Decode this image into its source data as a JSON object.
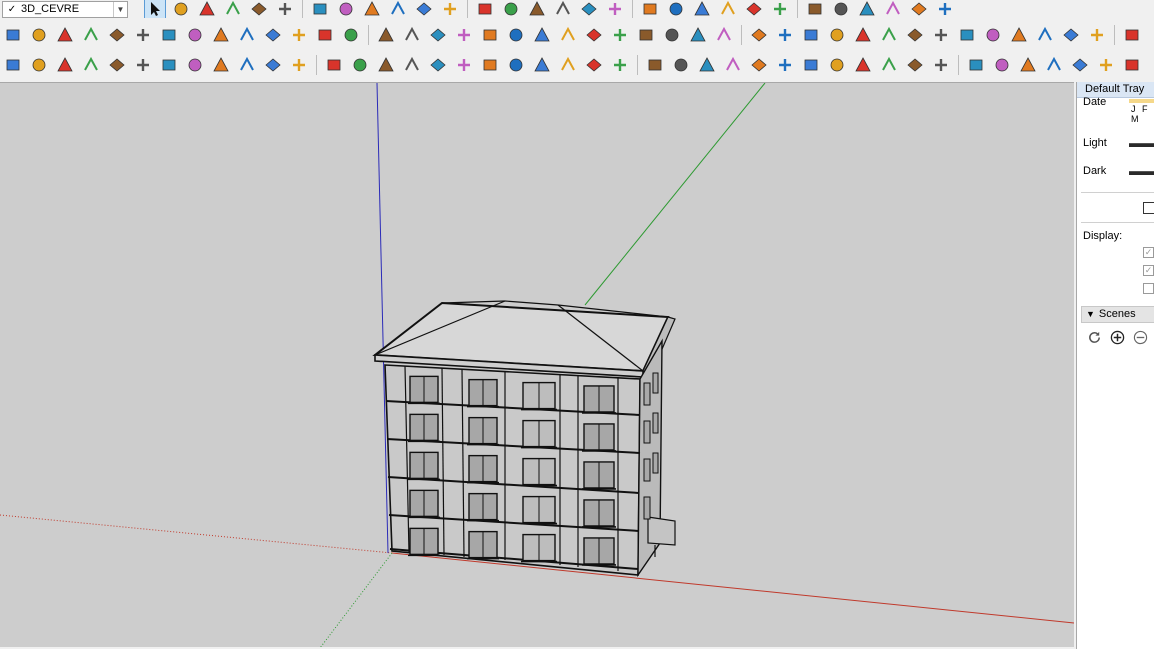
{
  "layer_dropdown": {
    "checkmark": "✓",
    "value": "3D_CEVRE",
    "arrow_icon": "chevron-down-icon"
  },
  "toolbar_row1": [
    "select-arrow-icon",
    "eraser-icon",
    "pencil-line-icon",
    "arc-icon",
    "rectangle-icon",
    "paint-bucket-icon",
    "push-pull-icon",
    "move-icon",
    "rotate-icon",
    "scale-icon",
    "tape-measure-icon",
    "text-icon",
    "paint-icon",
    "orbit-icon",
    "pan-icon",
    "zoom-icon",
    "zoom-extents-icon",
    "section-plane-icon",
    "warehouse-icon",
    "extension-icon",
    "user-account-icon",
    "house-icon",
    "house-front-icon",
    "house-outline-icon",
    "house-roof-icon",
    "layers-stack-icon",
    "layers-blue-icon",
    "layers-red-icon",
    "globe-icon",
    "export-icon"
  ],
  "toolbar_row2": [
    "cube-blue-icon",
    "plane-blue-icon",
    "plane-yellow-icon",
    "plane-green-icon",
    "plane-red-icon",
    "plane-white-icon",
    "undo-orange-icon",
    "stop-red-icon",
    "wall-icon",
    "flag-icon",
    "box-icon",
    "link-icon",
    "wave-icon",
    "curve-dots-icon",
    "cross-red-icon",
    "cross-green-icon",
    "grid-blue-icon",
    "prism-icon",
    "prism-green-icon",
    "warning-icon",
    "spiral-icon",
    "knot-icon",
    "knot-outline-icon",
    "move-arrows-icon",
    "tree-green-icon",
    "duplicate-icon",
    "tube-icon",
    "undo-red-icon",
    "stack-icon",
    "stack-red-icon",
    "tile-orange-icon",
    "mesh-icon",
    "window-icon",
    "grid-yellow-icon",
    "grid-orange-icon",
    "grid-orange2-icon",
    "scatter-icon",
    "circle-dots-icon",
    "qr-icon",
    "gray-box-icon",
    "component-icon",
    "component2-icon",
    "component3-icon"
  ],
  "toolbar_row3": [
    "logo-icon",
    "refresh-icon",
    "flag-stack-icon",
    "plus-circle-icon",
    "tree-icon",
    "terrain-icon",
    "checker-icon",
    "cloud-upload-icon",
    "settings-icon",
    "mail-icon",
    "info-icon",
    "offset-icon",
    "dotted-arc-icon",
    "fill-icon",
    "wand-icon",
    "circle-gear-icon",
    "lasso-icon",
    "bend-icon",
    "box-round-icon",
    "sphere-icon",
    "scissors-icon",
    "corner-icon",
    "corner2-icon",
    "draw-line-icon",
    "fillet-icon",
    "stamp-icon",
    "pulse-icon",
    "columns-icon",
    "rings-icon",
    "hand-icon",
    "leaf-icon",
    "angle-icon",
    "lines-icon",
    "slash-icon",
    "arrows-right-icon",
    "arrows-merge-icon",
    "arrows-split-icon",
    "drum-icon",
    "slope-icon",
    "fold-icon",
    "peel-icon",
    "strips-icon",
    "grid-dark-icon"
  ],
  "tray": {
    "title": "Default Tray",
    "date_label": "Date",
    "date_months": "J F M",
    "light_label": "Light",
    "dark_label": "Dark",
    "display_label": "Display:",
    "scenes_label": "Scenes",
    "scene_tools": [
      "refresh-icon",
      "add-scene-icon",
      "remove-scene-icon"
    ]
  },
  "colors": {
    "viewport_bg": "#cdcdcd",
    "axis_red": "#c0392b",
    "axis_green": "#2e9a32",
    "axis_blue": "#2b2bb8",
    "tray_header": "#dae6f4"
  }
}
